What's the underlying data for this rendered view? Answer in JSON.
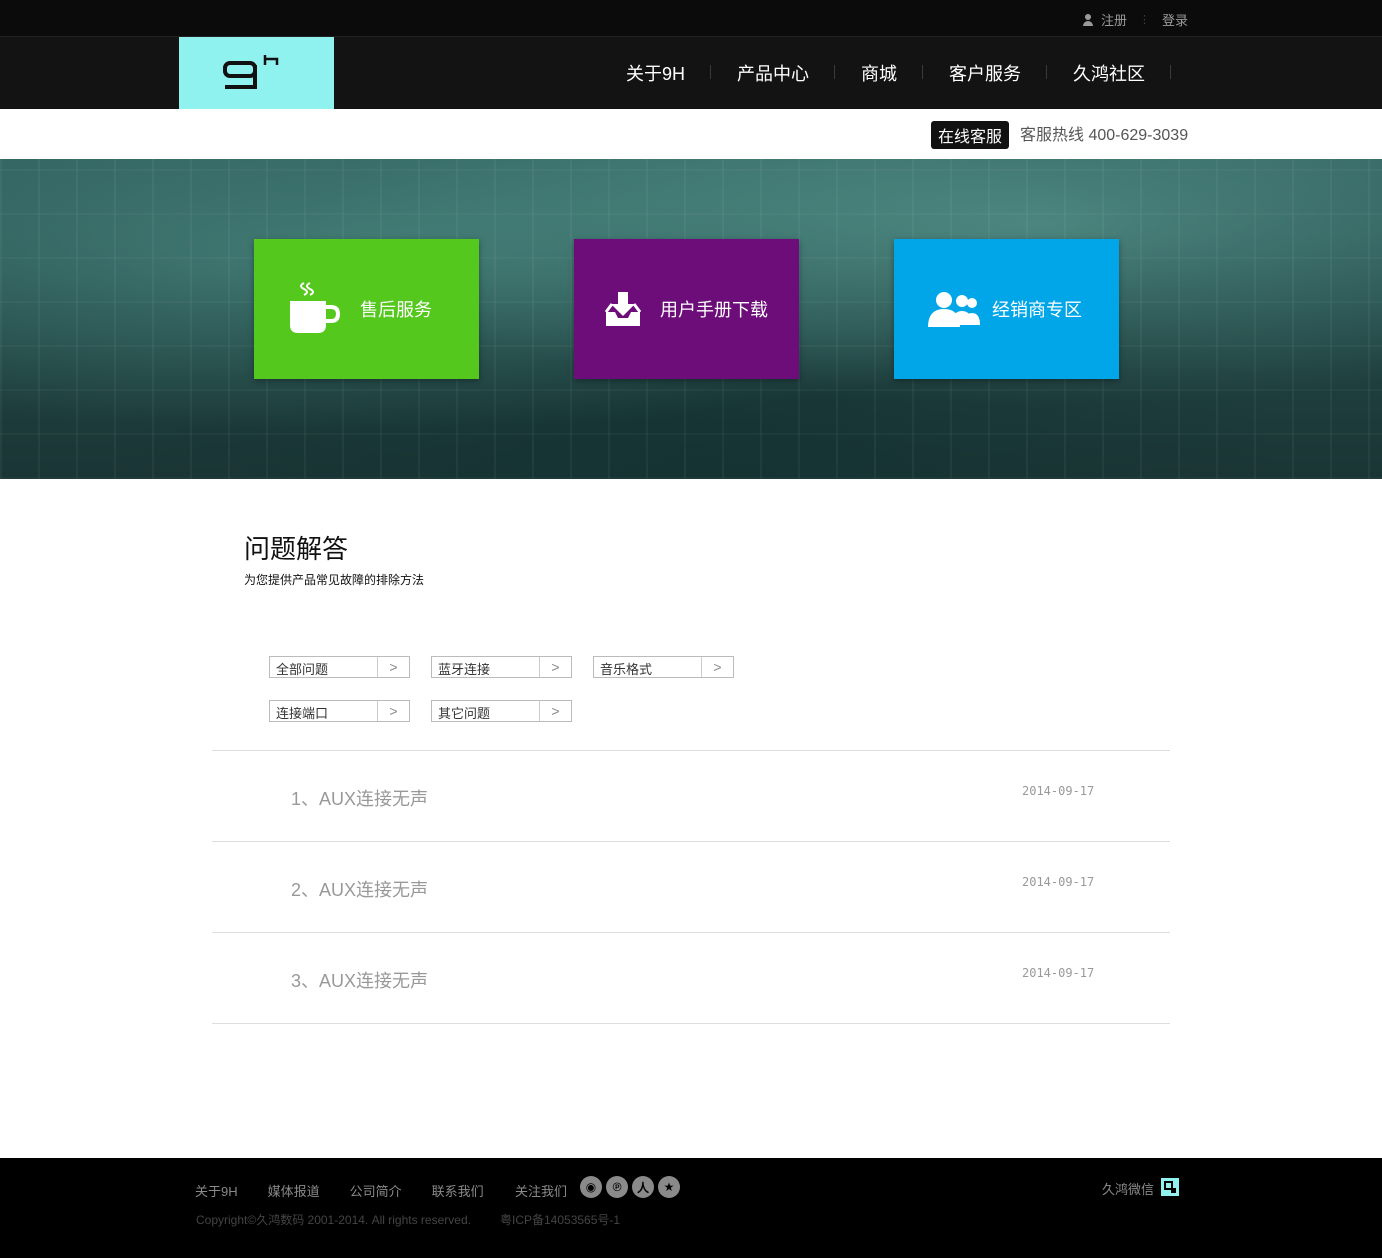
{
  "topbar": {
    "register": "注册",
    "login": "登录"
  },
  "nav": {
    "items": [
      {
        "label": "关于9H"
      },
      {
        "label": "产品中心"
      },
      {
        "label": "商城"
      },
      {
        "label": "客户服务"
      },
      {
        "label": "久鸿社区"
      }
    ]
  },
  "service": {
    "online": "在线客服",
    "hotline": "客服热线 400-629-3039"
  },
  "tiles": [
    {
      "label": "售后服务",
      "color": "#55c81e",
      "icon": "coffee-cup-icon"
    },
    {
      "label": "用户手册下载",
      "color": "#6d0d7a",
      "icon": "download-tray-icon"
    },
    {
      "label": "经销商专区",
      "color": "#00a6e8",
      "icon": "users-icon"
    }
  ],
  "faq": {
    "title": "问题解答",
    "subtitle": "为您提供产品常见故障的排除方法",
    "filters": [
      {
        "label": "全部问题"
      },
      {
        "label": "蓝牙连接"
      },
      {
        "label": "音乐格式"
      },
      {
        "label": "连接端口"
      },
      {
        "label": "其它问题"
      }
    ],
    "items": [
      {
        "question": "1、AUX连接无声",
        "date": "2014-09-17"
      },
      {
        "question": "2、AUX连接无声",
        "date": "2014-09-17"
      },
      {
        "question": "3、AUX连接无声",
        "date": "2014-09-17"
      }
    ]
  },
  "footer": {
    "links": [
      "关于9H",
      "媒体报道",
      "公司简介",
      "联系我们"
    ],
    "follow": "关注我们",
    "copyright": "Copyright©久鸿数码 2001-2014. All rights reserved.",
    "icp": "粤ICP备14053565号-1",
    "wechat": "久鸿微信"
  },
  "colors": {
    "brand": "#8ff2ee",
    "after_sales": "#55c81e",
    "manual": "#6d0d7a",
    "dealer": "#00a6e8"
  }
}
